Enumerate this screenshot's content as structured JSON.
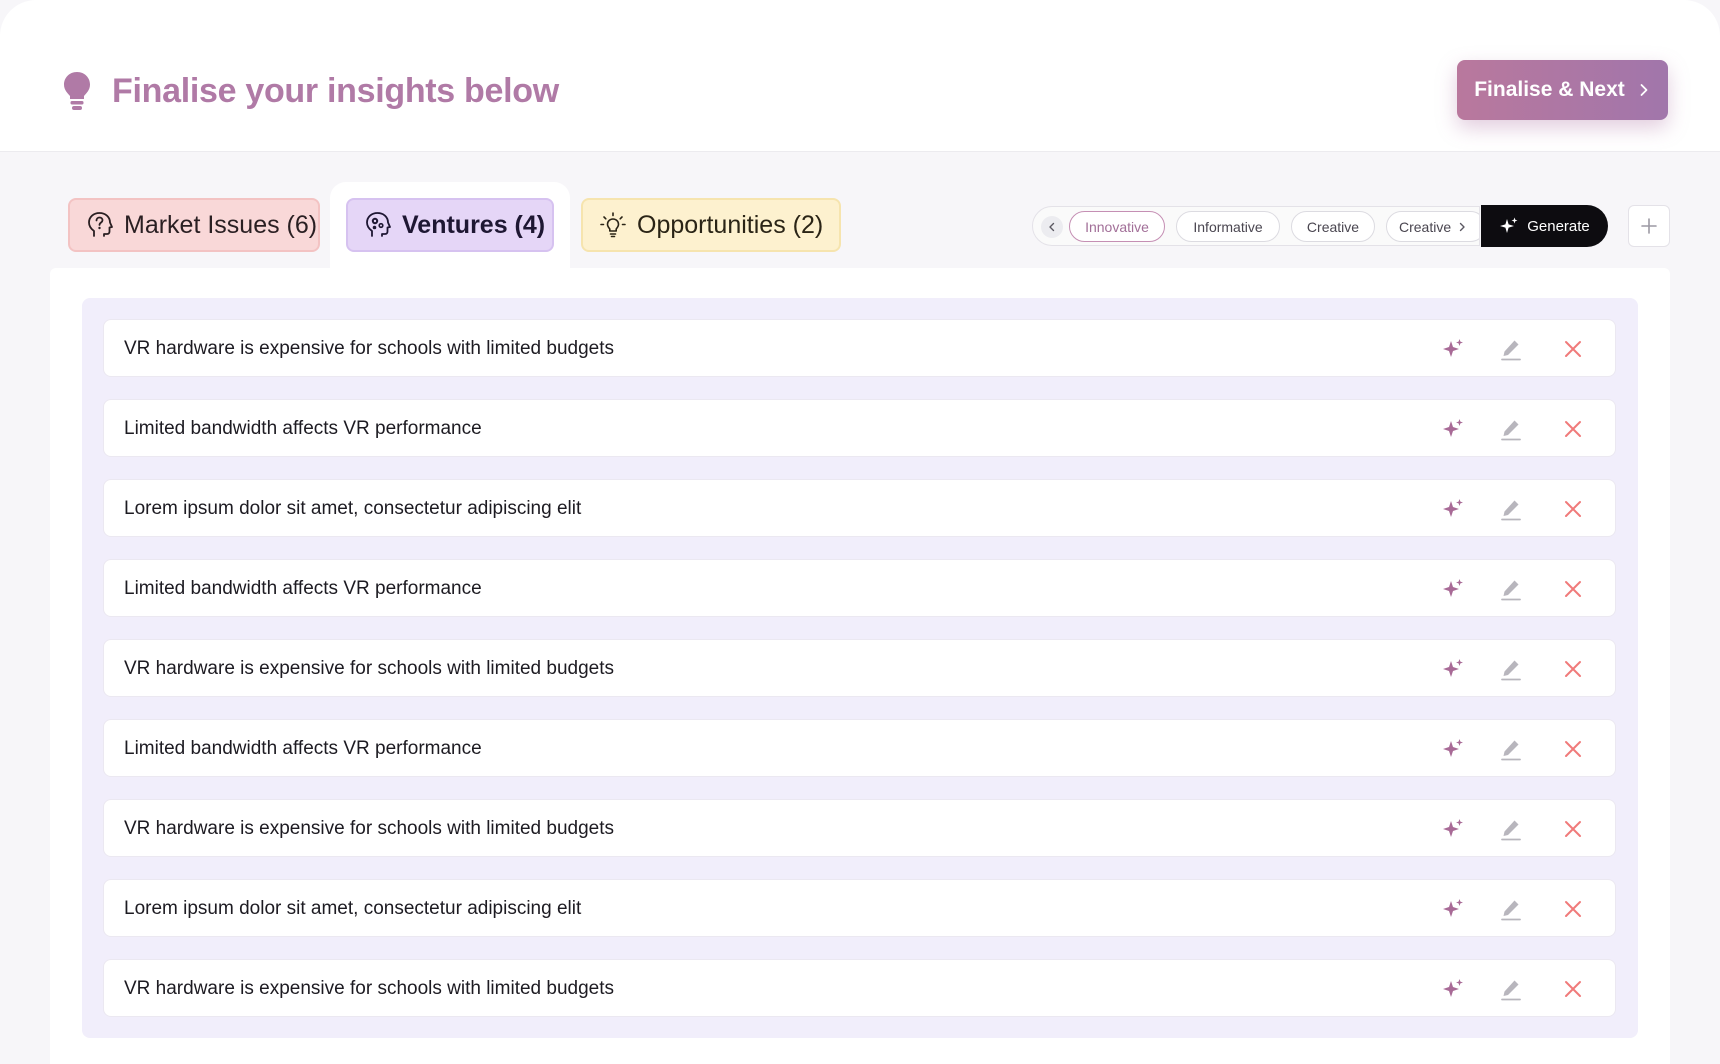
{
  "header": {
    "title": "Finalise your insights below",
    "icon": "lightbulb-icon",
    "finalise_label": "Finalise & Next"
  },
  "tabs": [
    {
      "label": "Market Issues (6)",
      "icon": "question-head-icon",
      "color": "#f9d8d8"
    },
    {
      "label": "Ventures (4)",
      "icon": "head-gears-icon",
      "color": "#e5d6f7",
      "active": true
    },
    {
      "label": "Opportunities (2)",
      "icon": "bulb-glow-icon",
      "color": "#fdf1cf"
    }
  ],
  "tone_chips": {
    "items": [
      "Innovative",
      "Informative",
      "Creative",
      "Creative"
    ],
    "selected": "Innovative",
    "generate_label": "Generate"
  },
  "items": [
    "VR hardware is expensive for schools with limited budgets",
    "Limited bandwidth affects VR performance",
    "Lorem ipsum dolor sit amet, consectetur adipiscing elit",
    "Limited bandwidth affects VR performance",
    "VR hardware is expensive for schools with limited budgets",
    "Limited bandwidth affects VR performance",
    "VR hardware is expensive for schools with limited budgets",
    "Lorem ipsum dolor sit amet, consectetur adipiscing elit",
    "VR hardware is expensive for schools with limited budgets"
  ],
  "colors": {
    "accent": "#b07aa6",
    "sparkle": "#a86a96",
    "edit": "#b8b6bd",
    "delete": "#f07a7a"
  }
}
